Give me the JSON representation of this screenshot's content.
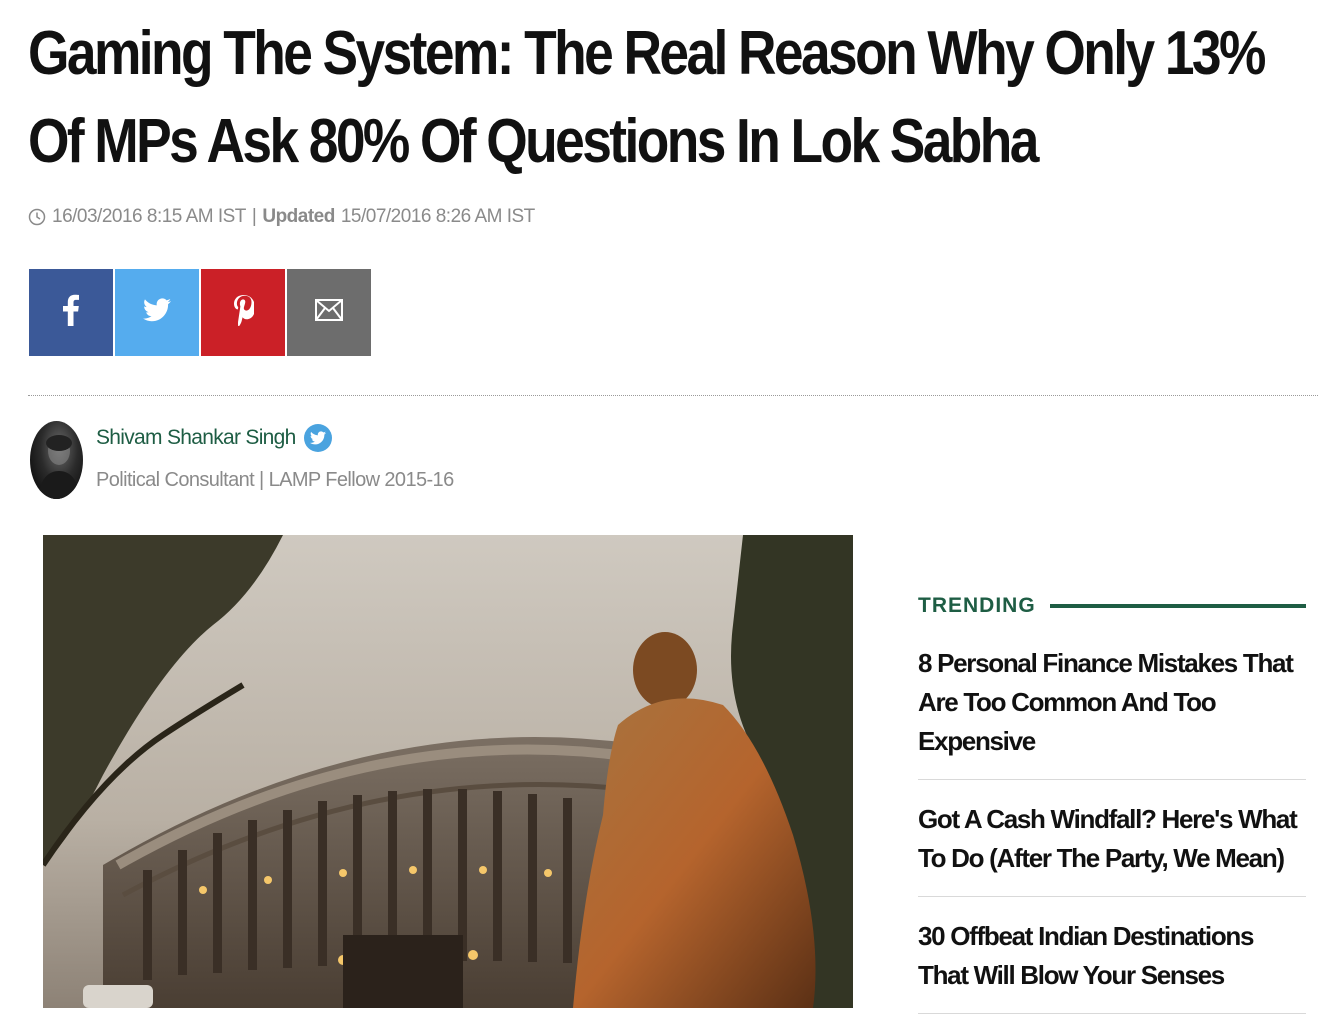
{
  "article": {
    "headline": "Gaming The System: The Real Reason Why Only 13% Of MPs Ask 80% Of Questions In Lok Sabha",
    "published": "16/03/2016 8:15 AM IST",
    "separator": "|",
    "updated_label": "Updated",
    "updated": "15/07/2016 8:26 AM IST"
  },
  "share": {
    "buttons": [
      {
        "name": "facebook",
        "icon": "facebook-icon",
        "color": "#3b5998"
      },
      {
        "name": "twitter",
        "icon": "twitter-icon",
        "color": "#55acee"
      },
      {
        "name": "pinterest",
        "icon": "pinterest-icon",
        "color": "#cb2027"
      },
      {
        "name": "email",
        "icon": "email-icon",
        "color": "#6d6d6d"
      }
    ]
  },
  "author": {
    "name": "Shivam Shankar Singh",
    "role": "Political Consultant | LAMP Fellow 2015-16"
  },
  "trending": {
    "label": "TRENDING",
    "items": [
      "8 Personal Finance Mistakes That Are Too Common And Too Expensive",
      "Got A Cash Windfall? Here's What To Do (After The Party, We Mean)",
      "30 Offbeat Indian Destinations That Will Blow Your Senses"
    ]
  },
  "colors": {
    "brand_green": "#1e5d44",
    "meta_gray": "#8a8a8a",
    "headline": "#111111"
  }
}
